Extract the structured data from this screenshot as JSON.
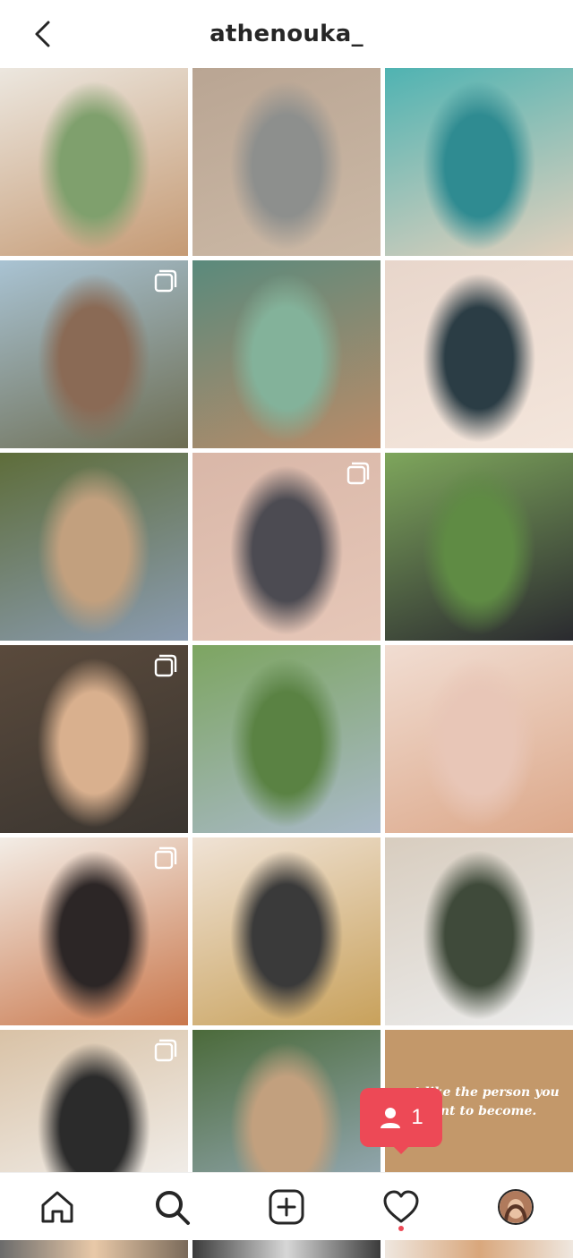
{
  "header": {
    "title": "athenouka_",
    "back_icon": "chevron-left-icon"
  },
  "posts": [
    {
      "id": "p1",
      "multi": false,
      "colors": [
        "#ece7df",
        "#7fa06d",
        "#c59a74"
      ]
    },
    {
      "id": "p2",
      "multi": false,
      "colors": [
        "#b9a593",
        "#8d8f8d",
        "#ccb9a6"
      ]
    },
    {
      "id": "p3",
      "multi": false,
      "colors": [
        "#4fb3b2",
        "#2f8b91",
        "#e2d0bd"
      ]
    },
    {
      "id": "p4",
      "multi": true,
      "colors": [
        "#a9c3d3",
        "#8a6a55",
        "#6d6d52"
      ]
    },
    {
      "id": "p5",
      "multi": false,
      "colors": [
        "#5a8a7c",
        "#83b29a",
        "#b98b68"
      ]
    },
    {
      "id": "p6",
      "multi": false,
      "colors": [
        "#e8d6cb",
        "#2b3d45",
        "#f4e6dc"
      ]
    },
    {
      "id": "p7",
      "multi": false,
      "colors": [
        "#5e6d3a",
        "#c2a07e",
        "#8a9bb0"
      ]
    },
    {
      "id": "p8",
      "multi": true,
      "colors": [
        "#d9b7a8",
        "#4c4b52",
        "#e6c7b8"
      ]
    },
    {
      "id": "p9",
      "multi": false,
      "colors": [
        "#7ea65c",
        "#5f8b44",
        "#2a2a2f"
      ]
    },
    {
      "id": "p10",
      "multi": true,
      "colors": [
        "#5a4a3c",
        "#d9b08e",
        "#3a3530"
      ]
    },
    {
      "id": "p11",
      "multi": false,
      "colors": [
        "#7da561",
        "#5a8243",
        "#a9b9c8"
      ]
    },
    {
      "id": "p12",
      "multi": false,
      "colors": [
        "#f1ddd2",
        "#e8c6b7",
        "#dca88a"
      ]
    },
    {
      "id": "p13",
      "multi": true,
      "colors": [
        "#f3ede6",
        "#2c2626",
        "#c9774c"
      ]
    },
    {
      "id": "p14",
      "multi": false,
      "colors": [
        "#f0e3d6",
        "#3a3a3a",
        "#c8a15b"
      ]
    },
    {
      "id": "p15",
      "multi": false,
      "colors": [
        "#d8cdbf",
        "#3f4a3a",
        "#ececec"
      ]
    },
    {
      "id": "p16",
      "multi": true,
      "colors": [
        "#d9c2a6",
        "#2b2b2b",
        "#f5f5f5"
      ]
    },
    {
      "id": "p17",
      "multi": false,
      "colors": [
        "#4b6a3a",
        "#c2a07e",
        "#9fb2c5"
      ]
    },
    {
      "id": "p18",
      "multi": false,
      "colors": [
        "#c3986a",
        "#c3986a",
        "#b88d5f"
      ],
      "quote": "act like the person you want to become."
    }
  ],
  "activity_badge": {
    "count": "1",
    "icon": "person-icon",
    "color": "#ed4956"
  },
  "tabbar": {
    "items": [
      {
        "name": "home",
        "icon": "home-icon"
      },
      {
        "name": "search",
        "icon": "search-icon"
      },
      {
        "name": "new-post",
        "icon": "plus-square-icon"
      },
      {
        "name": "activity",
        "icon": "heart-icon"
      },
      {
        "name": "profile",
        "icon": "avatar"
      }
    ]
  }
}
